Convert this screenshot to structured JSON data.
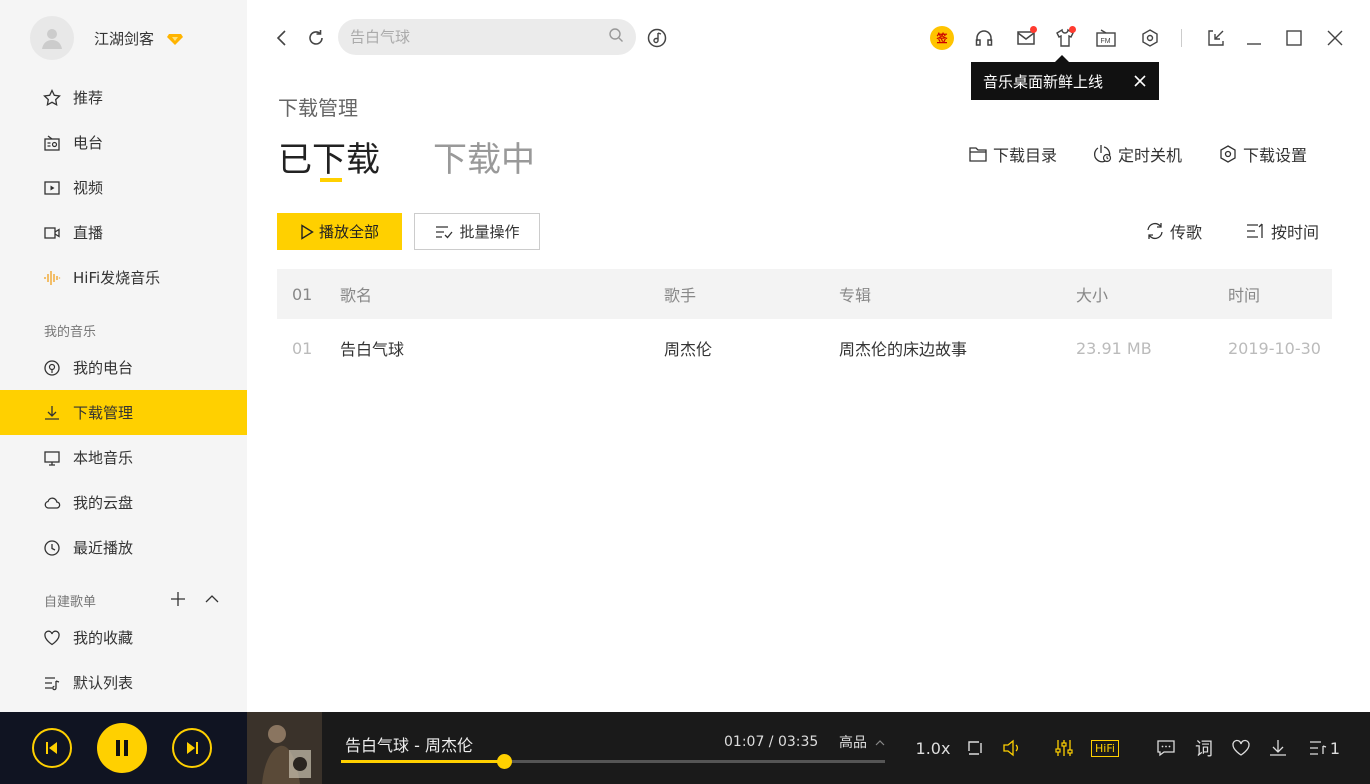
{
  "user": {
    "name": "江湖剑客"
  },
  "sidebar": {
    "items": [
      {
        "label": "推荐",
        "icon": "star-icon"
      },
      {
        "label": "电台",
        "icon": "radio-icon"
      },
      {
        "label": "视频",
        "icon": "video-icon"
      },
      {
        "label": "直播",
        "icon": "live-icon"
      },
      {
        "label": "HiFi发烧音乐",
        "icon": "waveform-icon"
      }
    ],
    "my_music_label": "我的音乐",
    "my_music": [
      {
        "label": "我的电台",
        "icon": "podcast-icon"
      },
      {
        "label": "下载管理",
        "icon": "download-icon",
        "active": true
      },
      {
        "label": "本地音乐",
        "icon": "monitor-icon"
      },
      {
        "label": "我的云盘",
        "icon": "cloud-icon"
      },
      {
        "label": "最近播放",
        "icon": "clock-icon"
      }
    ],
    "playlists_label": "自建歌单",
    "playlists": [
      {
        "label": "我的收藏",
        "icon": "heart-icon"
      },
      {
        "label": "默认列表",
        "icon": "playlist-icon"
      }
    ]
  },
  "search": {
    "placeholder": "告白气球"
  },
  "tooltip": {
    "text": "音乐桌面新鲜上线"
  },
  "topbar": {
    "checkin_label": "签"
  },
  "page": {
    "breadcrumb": "下载管理",
    "tabs": [
      "已下载",
      "下载中"
    ],
    "actions": {
      "folder": "下载目录",
      "timer": "定时关机",
      "settings": "下载设置"
    },
    "play_all": "播放全部",
    "batch": "批量操作",
    "upload": "传歌",
    "sort": "按时间"
  },
  "table": {
    "headers": {
      "index": "01",
      "name": "歌名",
      "artist": "歌手",
      "album": "专辑",
      "size": "大小",
      "time": "时间"
    },
    "rows": [
      {
        "index": "01",
        "name": "告白气球",
        "artist": "周杰伦",
        "album": "周杰伦的床边故事",
        "size": "23.91 MB",
        "time": "2019-10-30"
      }
    ]
  },
  "player": {
    "song": "告白气球 - 周杰伦",
    "time": "01:07 / 03:35",
    "quality": "高品",
    "speed": "1.0x",
    "hifi": "HiFi",
    "lyrics": "词",
    "queue_count": "1",
    "progress_fraction": 0.3
  },
  "colors": {
    "accent": "#ffd000",
    "player_bg": "#1a1a1a",
    "sidebar_bg": "#f5f5f5"
  }
}
